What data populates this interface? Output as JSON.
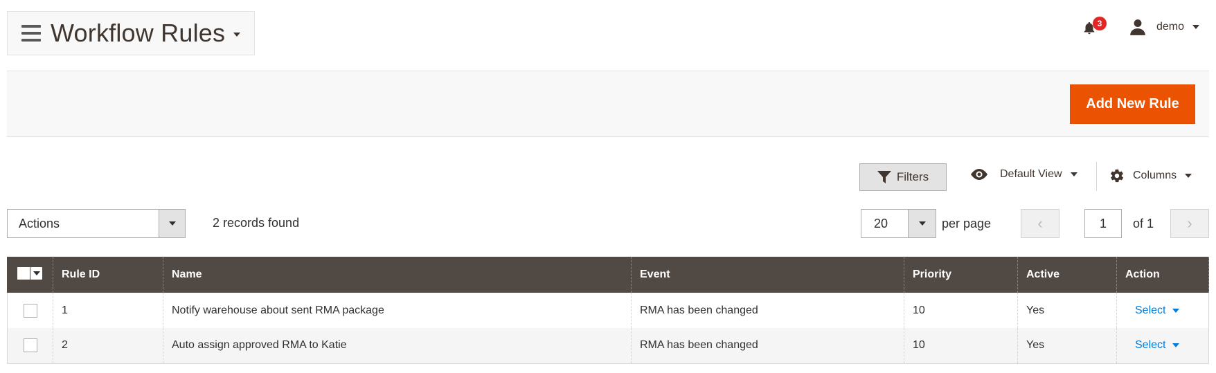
{
  "header": {
    "title": "Workflow Rules",
    "notifications_count": "3",
    "user_name": "demo"
  },
  "action_bar": {
    "add_button": "Add New Rule"
  },
  "toolbar": {
    "filters_label": "Filters",
    "view_label": "Default View",
    "columns_label": "Columns"
  },
  "mass_actions": {
    "selected": "Actions"
  },
  "records_found": "2 records found",
  "pager": {
    "per_page_value": "20",
    "per_page_label": "per page",
    "current_page": "1",
    "total_label": "of 1"
  },
  "grid": {
    "columns": [
      "Rule ID",
      "Name",
      "Event",
      "Priority",
      "Active",
      "Action"
    ],
    "rows": [
      {
        "id": "1",
        "name": "Notify warehouse about sent RMA package",
        "event": "RMA has been changed",
        "priority": "10",
        "active": "Yes",
        "action": "Select"
      },
      {
        "id": "2",
        "name": "Auto assign approved RMA to Katie",
        "event": "RMA has been changed",
        "priority": "10",
        "active": "Yes",
        "action": "Select"
      }
    ]
  },
  "colors": {
    "accent": "#eb5202",
    "grid_header": "#514943",
    "link": "#007bdb",
    "badge": "#e22626"
  }
}
